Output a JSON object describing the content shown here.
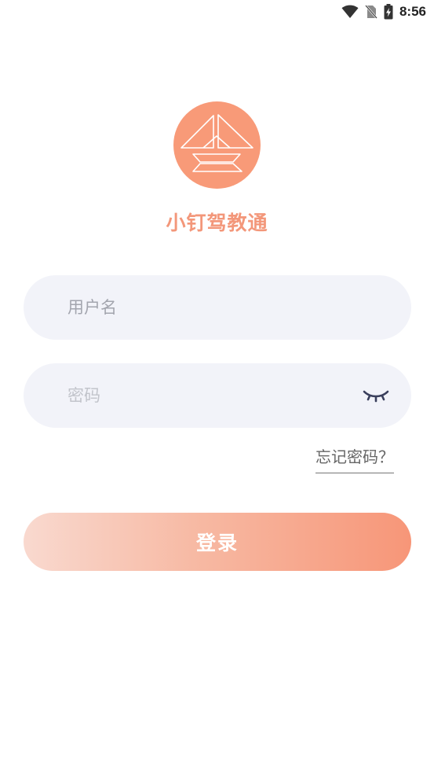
{
  "status_bar": {
    "time": "8:56",
    "icons": [
      "wifi-icon",
      "no-sim-icon",
      "battery-charging-icon"
    ]
  },
  "app": {
    "name": "小钉驾教通",
    "logo_icon": "app-logo-icon",
    "brand_color": "#f89a78"
  },
  "form": {
    "username": {
      "placeholder": "用户名",
      "value": ""
    },
    "password": {
      "placeholder": "密码",
      "value": "",
      "toggle_icon": "eye-closed-icon"
    },
    "forgot_password": "忘记密码？",
    "login_button": "登录"
  }
}
